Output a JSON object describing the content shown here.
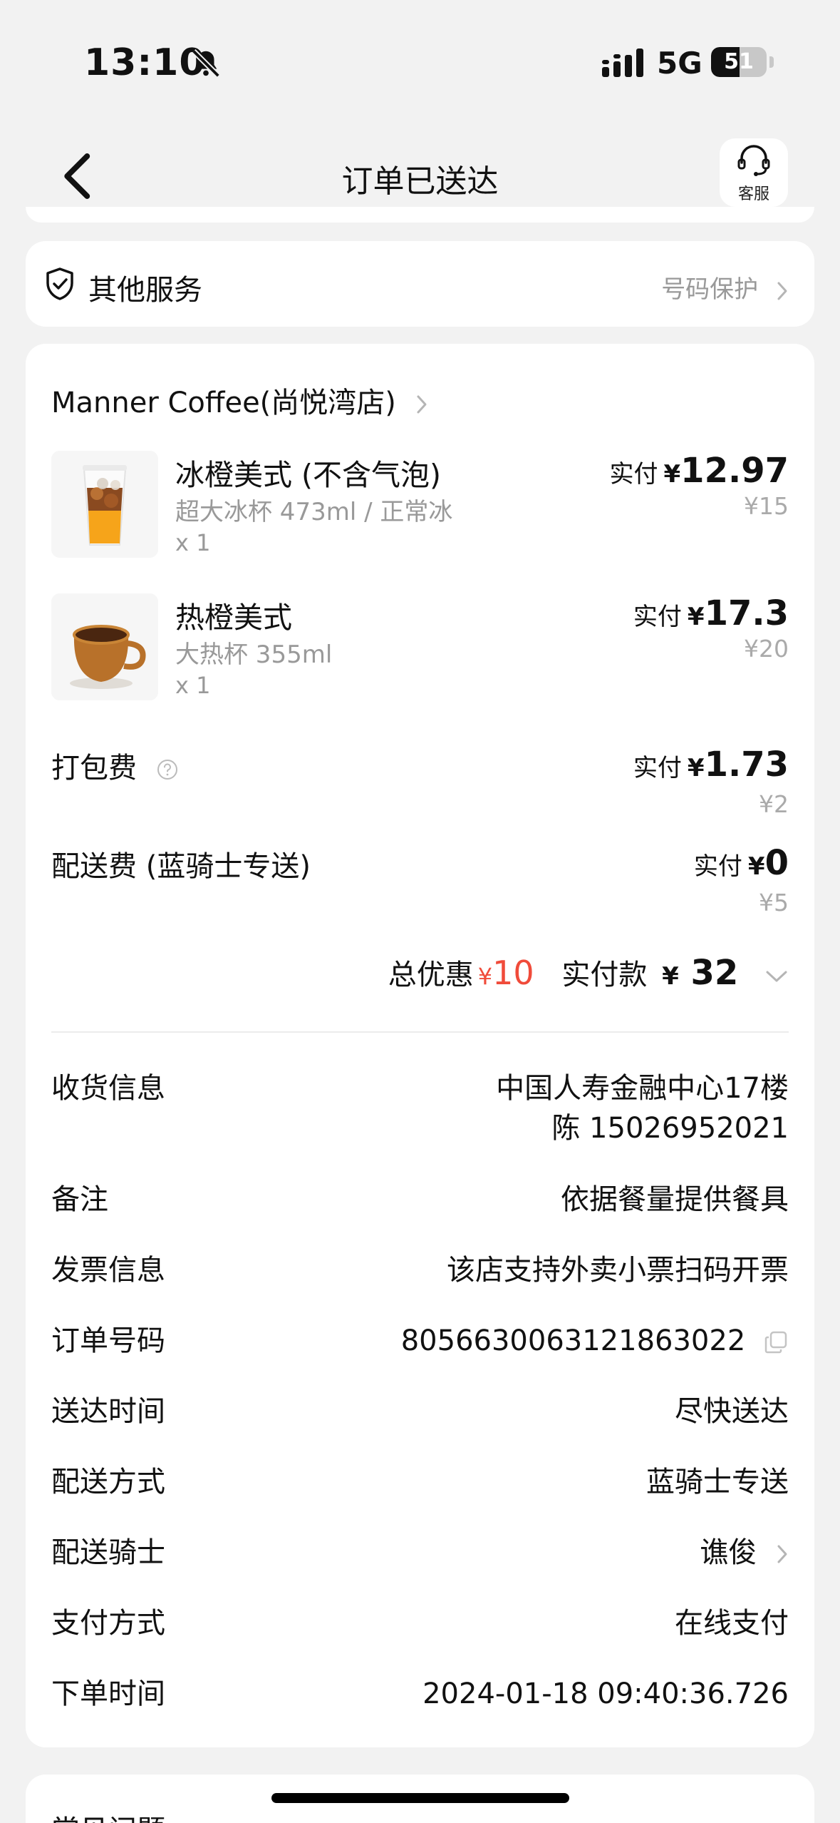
{
  "status_bar": {
    "time": "13:10",
    "network": "5G",
    "battery_level": "51",
    "icons": [
      "bell-slash-icon",
      "signal-icon",
      "battery-icon"
    ]
  },
  "nav": {
    "title": "订单已送达",
    "customer_service": "客服",
    "icons": [
      "chevron-left-icon",
      "headset-icon"
    ]
  },
  "service": {
    "title": "其他服务",
    "right_text": "号码保护",
    "icons": [
      "shield-check-icon",
      "chevron-right-icon"
    ]
  },
  "store": {
    "name": "Manner Coffee(尚悦湾店)"
  },
  "items": [
    {
      "name": "冰橙美式 (不含气泡)",
      "spec": "超大冰杯 473ml / 正常冰",
      "qty": "x 1",
      "pay_label": "实付",
      "currency": "¥",
      "paid": "12.97",
      "original": "¥15"
    },
    {
      "name": "热橙美式",
      "spec": "大热杯 355ml",
      "qty": "x 1",
      "pay_label": "实付",
      "currency": "¥",
      "paid": "17.3",
      "original": "¥20"
    }
  ],
  "fees": [
    {
      "label": "打包费",
      "pay_label": "实付",
      "currency": "¥",
      "paid": "1.73",
      "original": "¥2"
    },
    {
      "label": "配送费 (蓝骑士专送)",
      "pay_label": "实付",
      "currency": "¥",
      "paid": "0",
      "original": "¥5"
    }
  ],
  "totals": {
    "discount_label": "总优惠",
    "discount_currency": "¥",
    "discount": "10",
    "paid_label": "实付款",
    "paid_currency": "¥",
    "paid": "32"
  },
  "info": {
    "address_label": "收货信息",
    "address_line1": "中国人寿金融中心17楼",
    "address_line2": "陈 15026952021",
    "note_label": "备注",
    "note": "依据餐量提供餐具",
    "invoice_label": "发票信息",
    "invoice": "该店支持外卖小票扫码开票",
    "order_no_label": "订单号码",
    "order_no": "8056630063121863022",
    "delivery_time_label": "送达时间",
    "delivery_time": "尽快送达",
    "delivery_method_label": "配送方式",
    "delivery_method": "蓝骑士专送",
    "rider_label": "配送骑士",
    "rider": "谯俊",
    "payment_label": "支付方式",
    "payment": "在线支付",
    "order_time_label": "下单时间",
    "order_time": "2024-01-18 09:40:36.726"
  },
  "bottom": {
    "title": "常见问题"
  },
  "colors": {
    "background": "#f2f2f2",
    "card": "#ffffff",
    "discount_red": "#f04b3a",
    "muted_text": "#999999"
  }
}
